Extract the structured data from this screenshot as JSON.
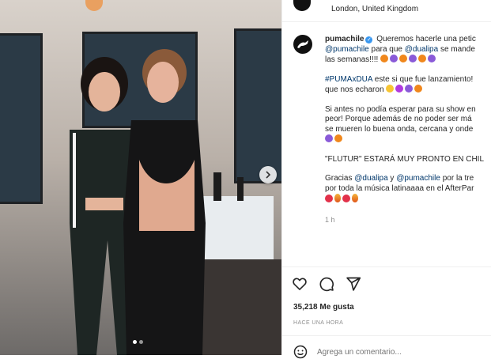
{
  "location": {
    "text": "London, United Kingdom"
  },
  "post": {
    "username": "pumachile",
    "caption": {
      "line1": " Queremos hacerle una petic",
      "line2_mention1": "@pumachile",
      "line2_mid": " para que ",
      "line2_mention2": "@dualipa",
      "line2_end": " se mande",
      "line3": "las semanas!!!! ",
      "hashtag": "#PUMAxDUA",
      "line4_rest": " este si que fue lanzamiento!",
      "line5": "que nos echaron ",
      "line6": "Si antes no podía esperar para su show en",
      "line7": "peor! Porque además de no poder ser má",
      "line8": "se mueren lo buena onda, cercana y onde",
      "line9": "\"FLUTUR\" ESTARÁ MUY PRONTO EN CHIL",
      "line10_start": "Gracias ",
      "line10_mention1": "@dualipa",
      "line10_mid": " y ",
      "line10_mention2": "@pumachile",
      "line10_end": " por la tre",
      "line11": "por toda la música latinaaaa en el AfterPar"
    },
    "time_ago": "1 h",
    "likes": "35,218 Me gusta",
    "posted": "HACE UNA HORA",
    "comment_placeholder": "Agrega un comentario..."
  },
  "colors": {
    "link": "#00376b",
    "verified": "#3897f0",
    "meta": "#8e8e8e"
  },
  "icons": [
    "puma-logo-icon",
    "verified-icon",
    "heart-icon",
    "comment-icon",
    "share-icon",
    "chevron-right-icon",
    "emoji-icon"
  ]
}
